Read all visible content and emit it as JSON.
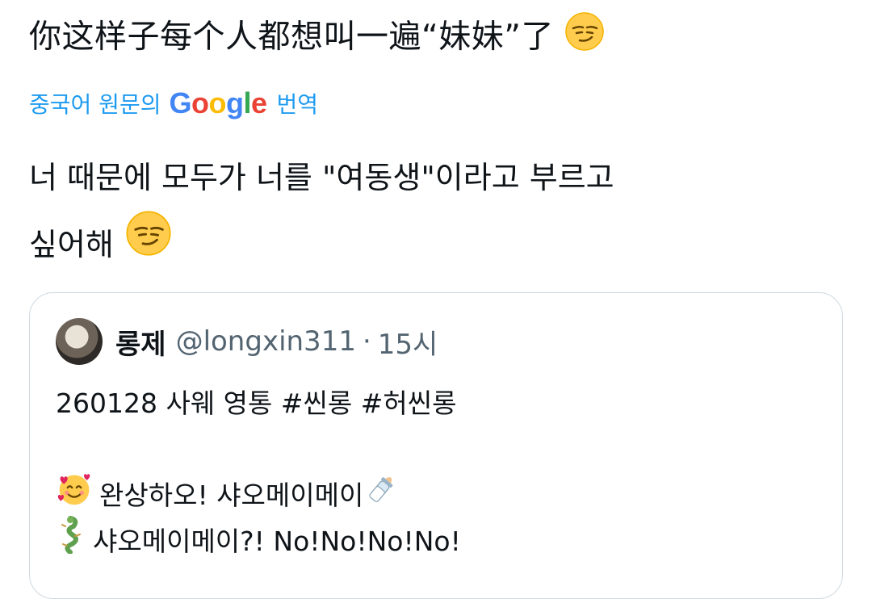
{
  "tweet": {
    "original_text": "你这样子每个人都想叫一遍“妹妹”了",
    "original_emoji": "smirking-face",
    "translation_source": "중국어 원문의",
    "translation_provider": "Google",
    "translation_suffix": "번역",
    "translated_line1": "너 때문에 모두가 너를 \"여동생\"이라고 부르고",
    "translated_line2": "싶어해",
    "translated_emoji": "smirking-face"
  },
  "quote": {
    "name": "롱제",
    "handle": "@longxin311",
    "separator": "·",
    "time": "15시",
    "line1": "260128 사웨 영통 #씬롱 #허씬롱",
    "line2_text": "완상하오! 샤오메이메이",
    "line2_emoji_before": "smiling-face-with-hearts",
    "line2_emoji_after": "baby-bottle",
    "line3_text": "샤오메이메이?! No!No!No!No!",
    "line3_emoji_before": "dragon"
  },
  "colors": {
    "link": "#1d9bf0",
    "secondary_text": "#536471",
    "card_border": "#cfd9de"
  }
}
